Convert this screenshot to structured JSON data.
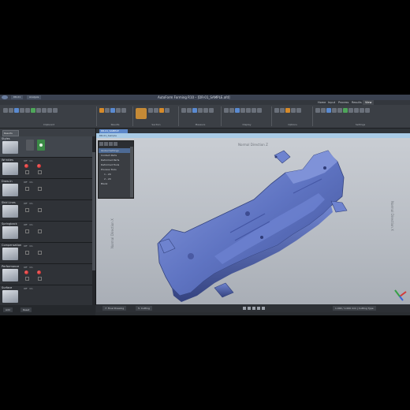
{
  "app": {
    "title": "AutoForm Forming R10 – [DR-01_SAMPLE.afd]",
    "quick_tabs": [
      "DR-01",
      "Analysis"
    ]
  },
  "ribbon": {
    "tabs": [
      "Home",
      "Input",
      "Process",
      "Results",
      "View"
    ],
    "active_tab": "View",
    "groups": [
      "Clipboard",
      "Results",
      "Section",
      "Measure",
      "Display",
      "Options",
      "Settings"
    ]
  },
  "left_panel": {
    "dropdown": "Results",
    "col_labels": [
      "Off",
      "On"
    ],
    "categories": [
      {
        "name": "Styles"
      },
      {
        "name": "Wrinkles"
      },
      {
        "name": "Draw-In"
      },
      {
        "name": "Skid Lines"
      },
      {
        "name": "Springback"
      },
      {
        "name": "Compensation"
      },
      {
        "name": "Performance"
      },
      {
        "name": "Surface"
      }
    ]
  },
  "viewport": {
    "tab": "DR-01_SAMPLE",
    "doc_name": "DR-01_Sample",
    "label_top": "Normal Direction Z",
    "label_left": "Normal Direction X",
    "label_right": "Normal Direction X",
    "tree": {
      "rows": [
        "Global Settings",
        "Contact Parts",
        "Deformed Parts",
        "Deformed Tools",
        "Process Tools",
        "1 - 20",
        "2 - 20",
        "Blank"
      ]
    }
  },
  "bottom_bar": {
    "step_label": "7: Final Drawing",
    "mode": "5: Cutting",
    "info": "1.000 / 1.000 mm | Cutting Type",
    "status_buttons": [
      "Add",
      "Reset"
    ]
  },
  "colors": {
    "model": "#5f74c2",
    "accent": "#5c87c9",
    "red_dot": "#d42a2a",
    "green_toggle": "#3b8a46"
  }
}
